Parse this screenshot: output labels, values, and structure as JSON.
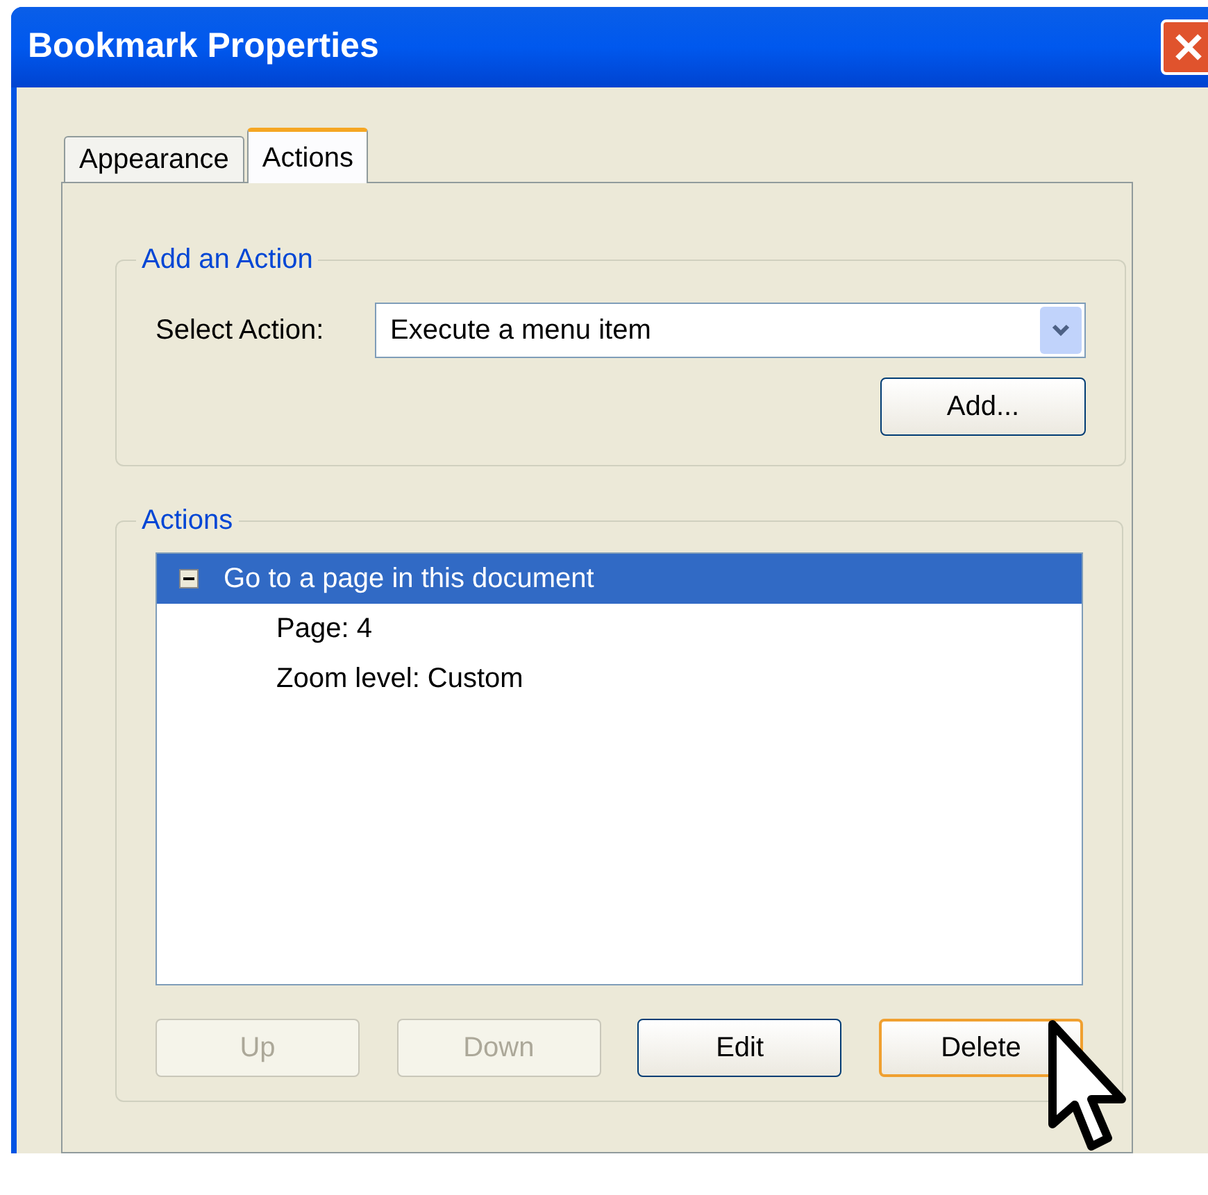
{
  "window": {
    "title": "Bookmark Properties"
  },
  "tabs": [
    {
      "label": "Appearance",
      "selected": false
    },
    {
      "label": "Actions",
      "selected": true
    }
  ],
  "add_action": {
    "legend": "Add an Action",
    "select_label": "Select Action:",
    "select_value": "Execute a menu item",
    "add_button": "Add..."
  },
  "actions": {
    "legend": "Actions",
    "items": [
      {
        "label": "Go to a page in this document",
        "selected": true,
        "expanded": true,
        "children": [
          {
            "label": "Page: 4",
            "selected": false
          },
          {
            "label": "Zoom level: Custom",
            "selected": false
          }
        ]
      }
    ]
  },
  "buttons": [
    {
      "label": "Up",
      "disabled": true,
      "focused": false
    },
    {
      "label": "Down",
      "disabled": true,
      "focused": false
    },
    {
      "label": "Edit",
      "disabled": false,
      "focused": false
    },
    {
      "label": "Delete",
      "disabled": false,
      "focused": true
    }
  ]
}
